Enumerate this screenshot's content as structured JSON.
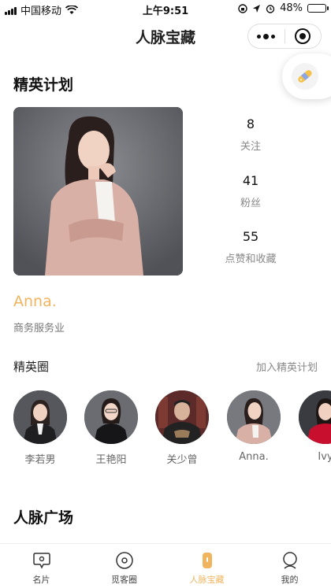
{
  "status_bar": {
    "carrier": "中国移动",
    "time": "上午9:51",
    "battery": "48%",
    "battery_level": 0.48
  },
  "nav": {
    "title": "人脉宝藏",
    "more_icon": "more-dots-icon",
    "close_icon": "target-circle-icon"
  },
  "elite": {
    "section_title": "精英计划",
    "stats": [
      {
        "value": "8",
        "label": "关注"
      },
      {
        "value": "41",
        "label": "粉丝"
      },
      {
        "value": "55",
        "label": "点赞和收藏"
      }
    ],
    "name": "Anna.",
    "industry": "商务服务业"
  },
  "circle": {
    "title": "精英圈",
    "join_label": "加入精英计划",
    "members": [
      {
        "name": "李若男"
      },
      {
        "name": "王艳阳"
      },
      {
        "name": "关少曾"
      },
      {
        "name": "Anna."
      },
      {
        "name": "Ivy"
      }
    ]
  },
  "plaza": {
    "section_title": "人脉广场"
  },
  "tabbar": {
    "items": [
      {
        "label": "名片",
        "icon": "card-icon"
      },
      {
        "label": "觅客圈",
        "icon": "circle-icon"
      },
      {
        "label": "人脉宝藏",
        "icon": "treasure-icon",
        "active": true
      },
      {
        "label": "我的",
        "icon": "profile-icon"
      }
    ]
  },
  "colors": {
    "accent": "#f0b45f"
  }
}
